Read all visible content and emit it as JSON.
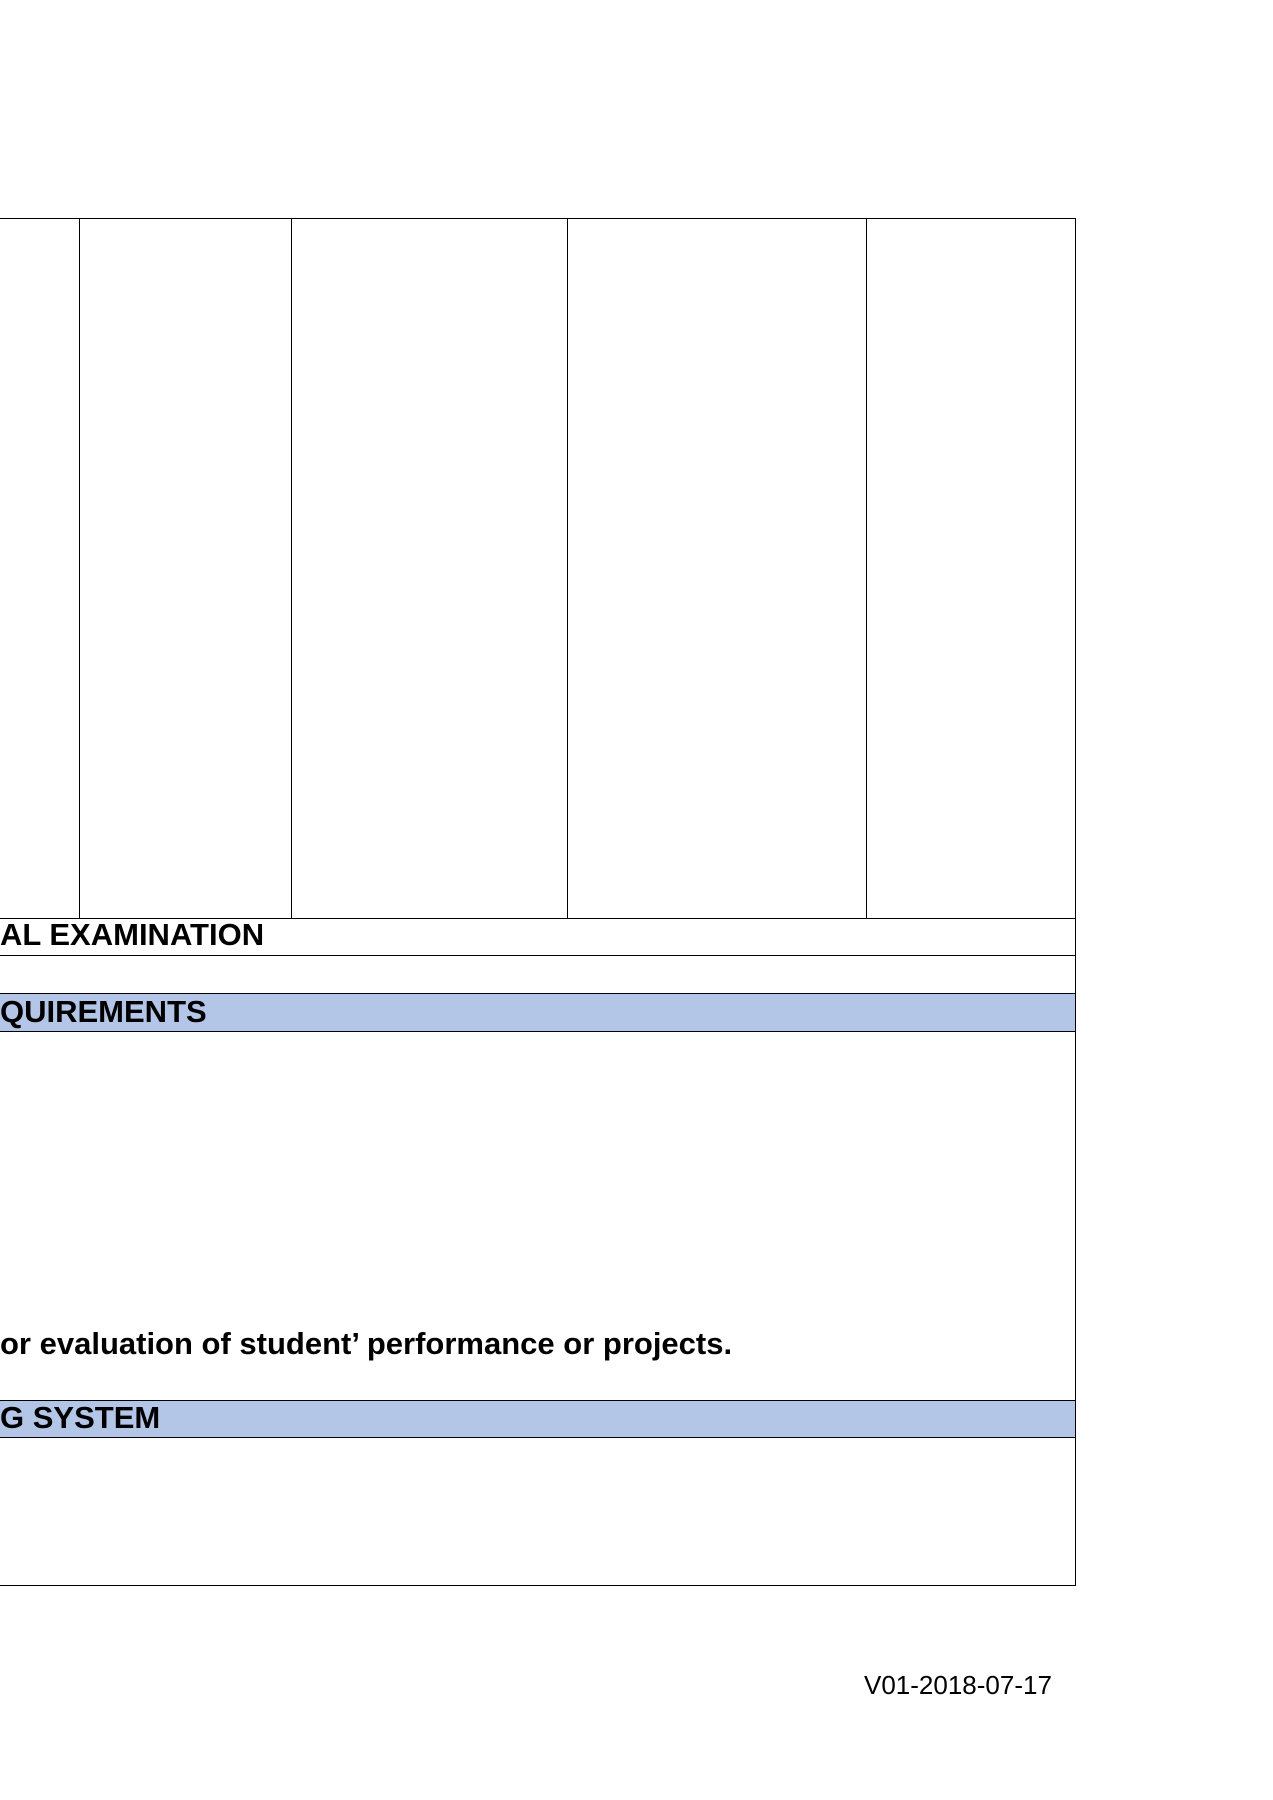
{
  "sections": {
    "final_exam_label": "AL EXAMINATION",
    "requirements_label": "QUIREMENTS",
    "requirements_note": "or evaluation of student’ performance or projects.",
    "grading_label": "G SYSTEM"
  },
  "footer": {
    "version_code": "V01-2018-07-17"
  },
  "colors": {
    "section_band": "#b4c6e7",
    "border": "#000000"
  }
}
